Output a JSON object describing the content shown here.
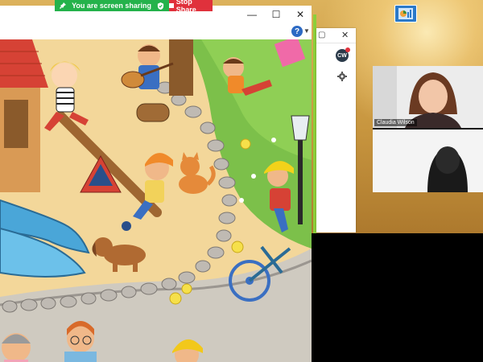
{
  "share_bar": {
    "status_text": "You are screen sharing",
    "stop_label": "Stop Share",
    "status_color": "#24b24b",
    "stop_color": "#e0313c"
  },
  "main_window": {
    "controls": {
      "minimize": "—",
      "maximize": "☐",
      "close": "✕"
    },
    "help_label": "?",
    "content": "cartoon-playground-illustration"
  },
  "side_window": {
    "minimize": "▢",
    "close": "✕",
    "avatar_initials": "CW",
    "settings_icon": "gear-icon"
  },
  "participants": [
    {
      "name": "Claudia Wilson"
    },
    {
      "name": ""
    }
  ],
  "desktop": {
    "icon": "chart-app-icon",
    "accent": "#2a79c9"
  }
}
